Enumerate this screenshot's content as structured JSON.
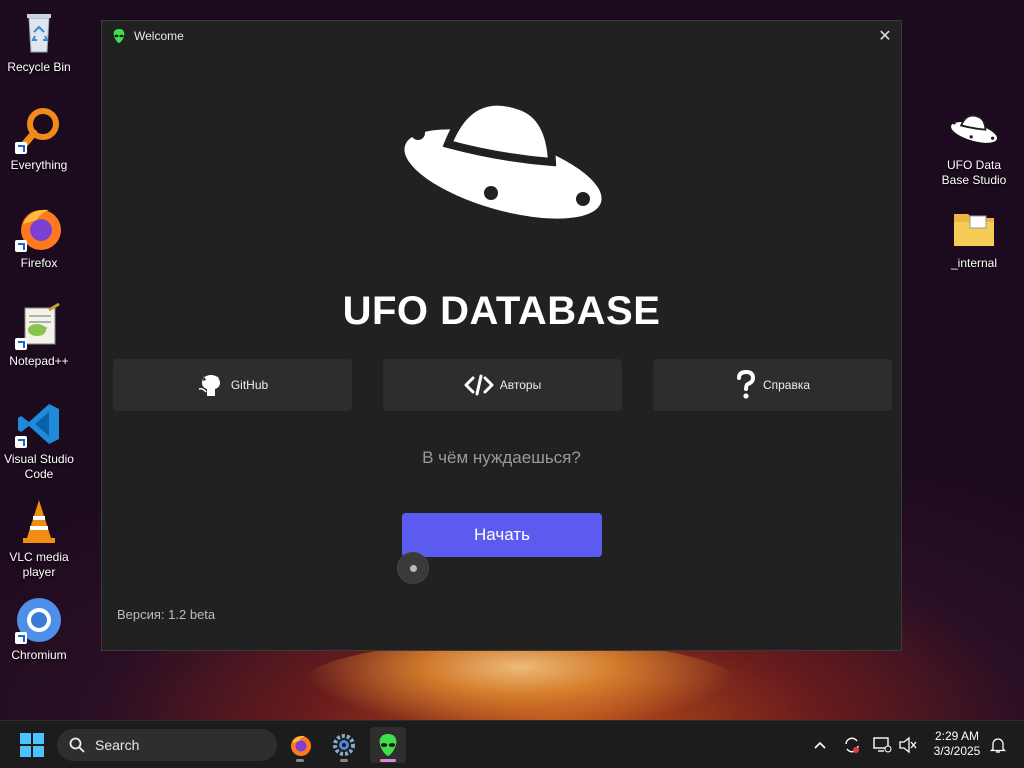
{
  "desktop": {
    "left_icons": [
      {
        "label": "Recycle Bin",
        "icon": "recycle-bin-icon"
      },
      {
        "label": "Everything",
        "icon": "everything-search-icon"
      },
      {
        "label": "Firefox",
        "icon": "firefox-icon"
      },
      {
        "label": "Notepad++",
        "icon": "notepad-plus-plus-icon"
      },
      {
        "label": "Visual Studio Code",
        "icon": "vscode-icon"
      },
      {
        "label": "VLC media player",
        "icon": "vlc-icon"
      },
      {
        "label": "Chromium",
        "icon": "chromium-icon"
      }
    ],
    "right_icons": [
      {
        "label": "UFO Data Base Studio",
        "icon": "ufo-icon"
      },
      {
        "label": "_internal",
        "icon": "folder-icon"
      }
    ]
  },
  "window": {
    "title": "Welcome",
    "app_title": "UFO DATABASE",
    "buttons": [
      {
        "label": "GitHub",
        "icon": "github-icon"
      },
      {
        "label": "Авторы",
        "icon": "code-icon"
      },
      {
        "label": "Справка",
        "icon": "question-icon"
      }
    ],
    "question": "В чём нуждаешься?",
    "start_label": "Начать",
    "version": "Версия: 1.2 beta",
    "accent_color": "#5b5bf0"
  },
  "taskbar": {
    "search_label": "Search",
    "apps": [
      "firefox-icon",
      "settings-icon",
      "alien-app-icon"
    ],
    "clock": {
      "time": "2:29 AM",
      "date": "3/3/2025"
    }
  }
}
